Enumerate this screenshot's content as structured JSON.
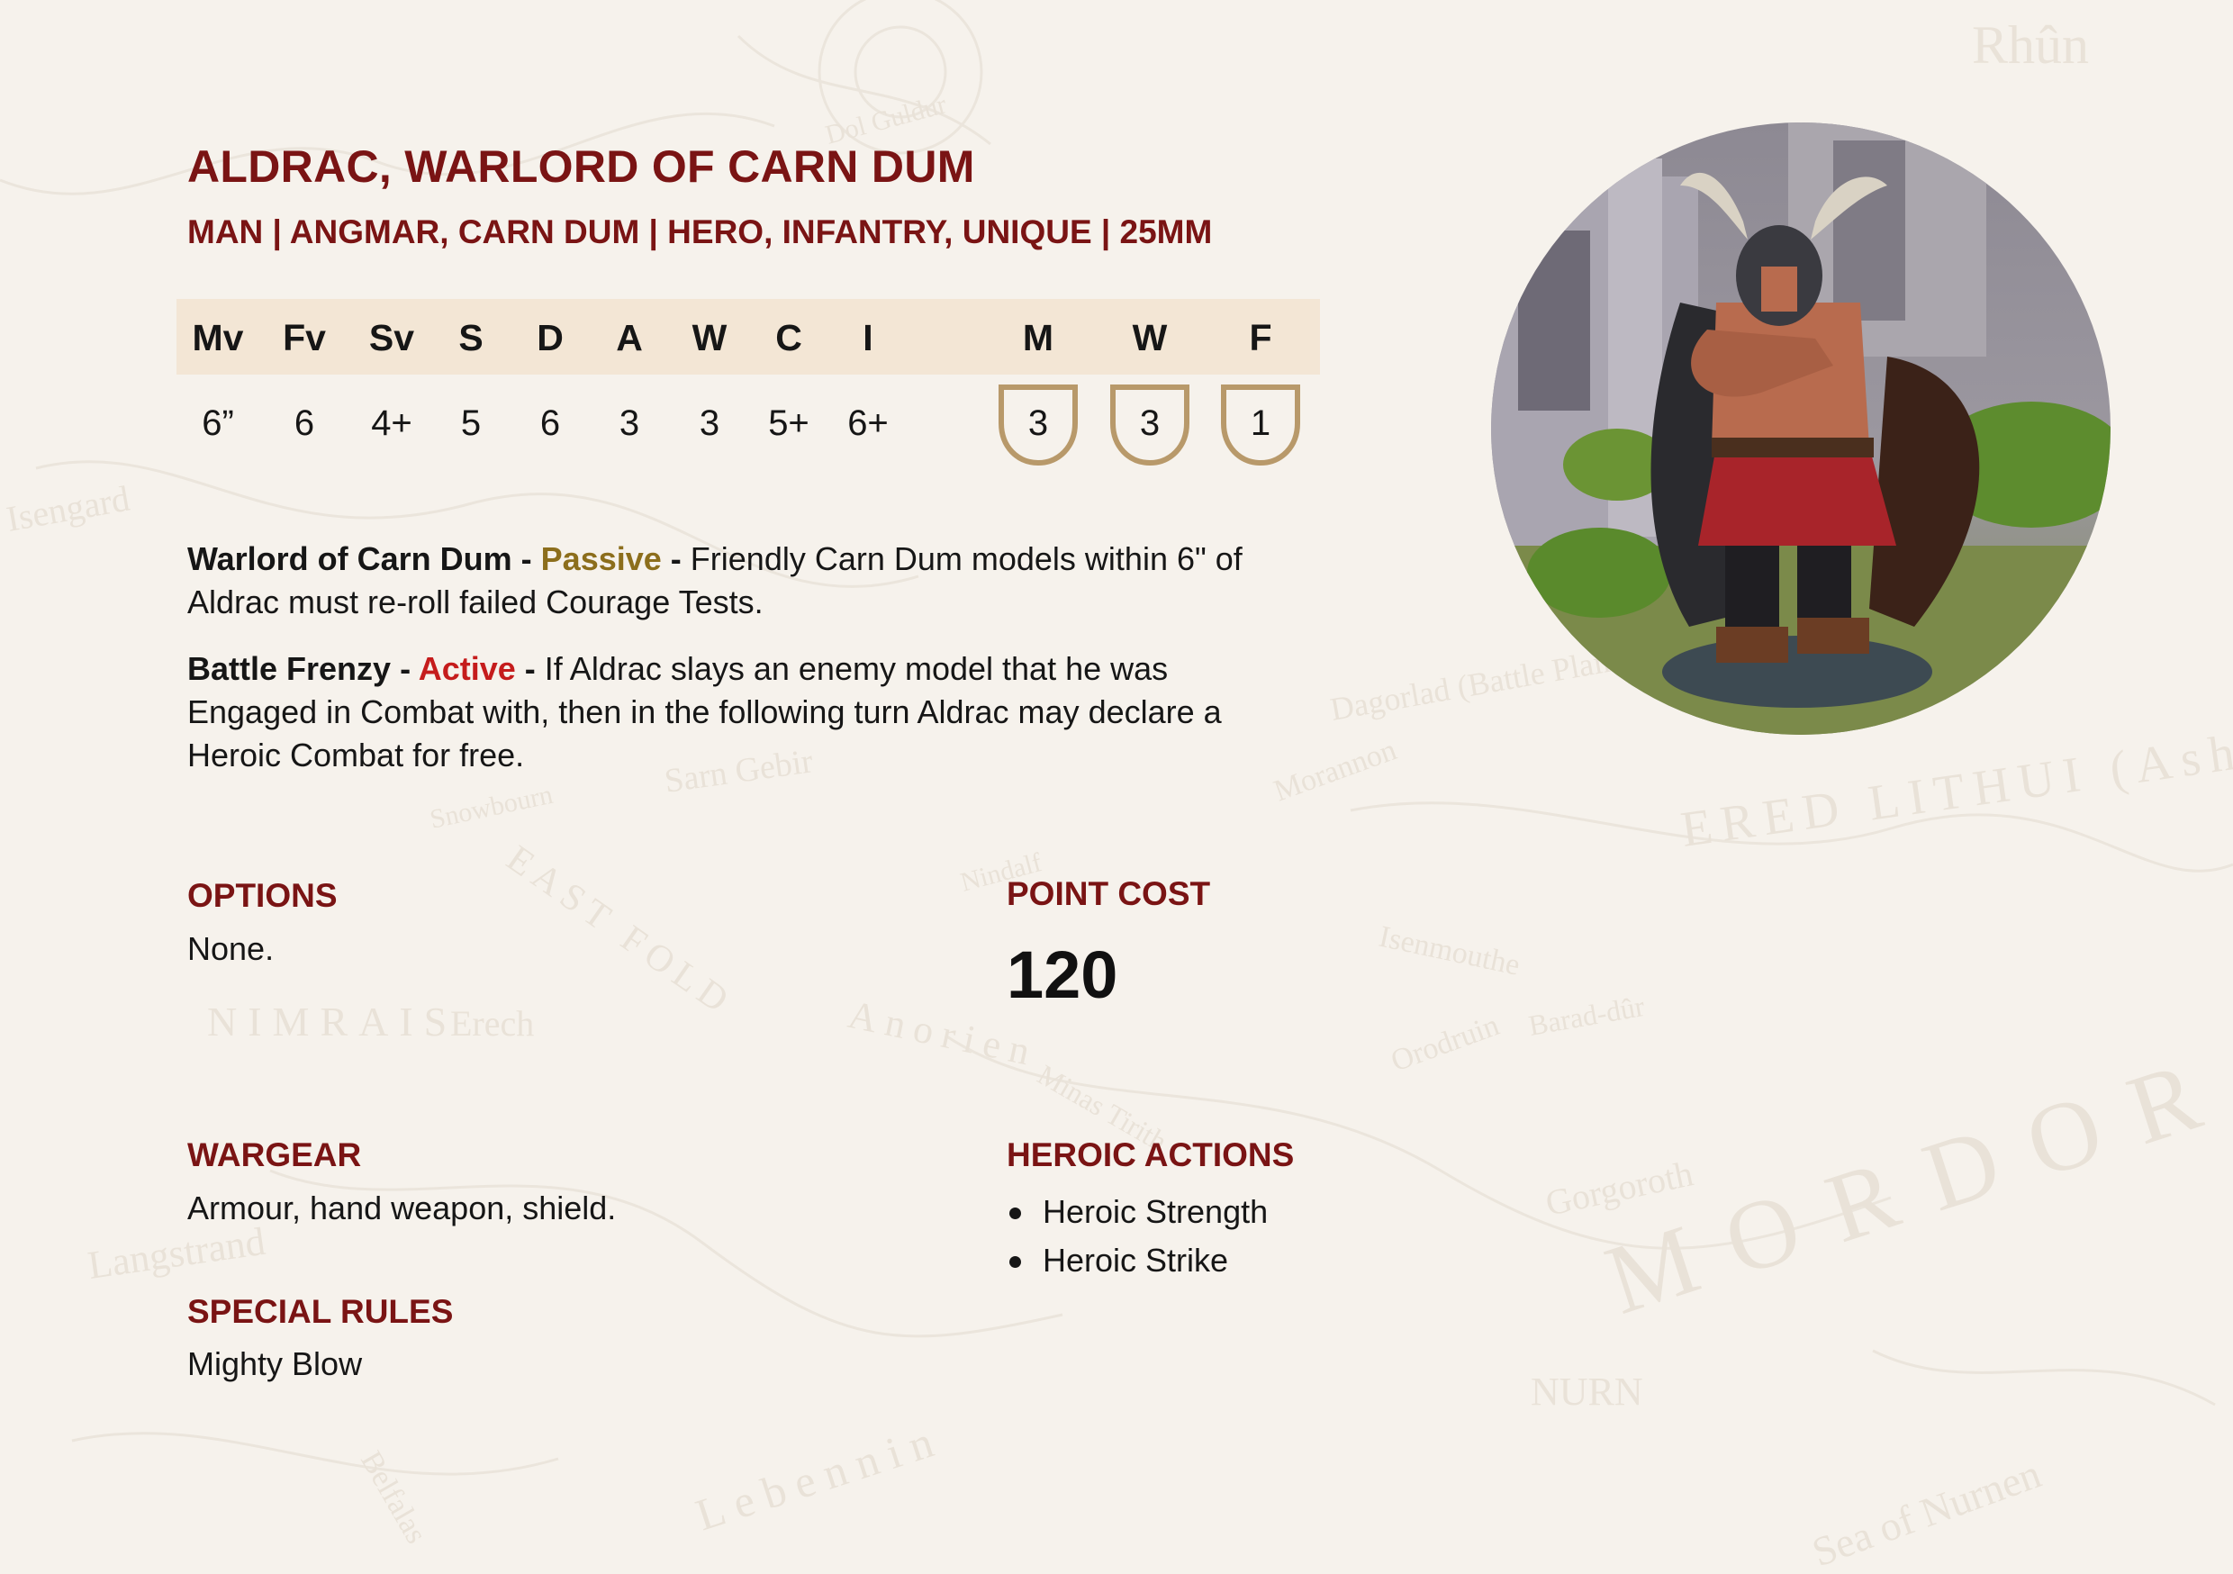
{
  "profile": {
    "name": "ALDRAC, WARLORD OF CARN DUM",
    "keywords": "MAN | ANGMAR, CARN DUM | HERO, INFANTRY, UNIQUE | 25MM"
  },
  "stats": {
    "columns": [
      {
        "label": "Mv",
        "value": "6”"
      },
      {
        "label": "Fv",
        "value": "6"
      },
      {
        "label": "Sv",
        "value": "4+"
      },
      {
        "label": "S",
        "value": "5"
      },
      {
        "label": "D",
        "value": "6"
      },
      {
        "label": "A",
        "value": "3"
      },
      {
        "label": "W",
        "value": "3"
      },
      {
        "label": "C",
        "value": "5+"
      },
      {
        "label": "I",
        "value": "6+"
      }
    ],
    "heroic": [
      {
        "label": "M",
        "value": "3"
      },
      {
        "label": "W",
        "value": "3"
      },
      {
        "label": "F",
        "value": "1"
      }
    ]
  },
  "rules": [
    {
      "name": "Warlord of Carn Dum",
      "separator": " - ",
      "type": "Passive",
      "text": "Friendly Carn Dum models within 6\" of Aldrac must re-roll failed Courage Tests."
    },
    {
      "name": "Battle Frenzy",
      "separator": " - ",
      "type": "Active",
      "text": "If Aldrac slays an enemy model that he was Engaged in Combat with, then in the following turn Aldrac may declare a Heroic Combat for free."
    }
  ],
  "options": {
    "title": "OPTIONS",
    "text": "None."
  },
  "point_cost": {
    "title": "POINT COST",
    "value": "120"
  },
  "wargear": {
    "title": "WARGEAR",
    "text": "Armour, hand weapon, shield."
  },
  "special_rules": {
    "title": "SPECIAL RULES",
    "text": "Mighty Blow"
  },
  "heroic_actions": {
    "title": "HEROIC ACTIONS",
    "items": [
      "Heroic Strength",
      "Heroic Strike"
    ]
  },
  "background_map_labels": [
    "Rhûn",
    "Isengard",
    "MORDOR",
    "ERED LITHUI (Ash",
    "NURN",
    "Sea of Nurnen",
    "Dagorlad (Battle Plain)",
    "Barad-dûr",
    "Gorgoroth",
    "Orodruin",
    "Morannon",
    "Isenmouthe",
    "NIMRAIS",
    "Erech",
    "Sarn Gebir",
    "Dol Guldur",
    "Nindalf",
    "EAST FOLD",
    "Snowbourn",
    "Anorien",
    "Minas Tirith",
    "Langstrand",
    "Belfalas",
    "Lebennin"
  ],
  "colors": {
    "accent": "#7a1414",
    "passive": "#8c6e1c",
    "active": "#c51c1c",
    "stat_band": "#f3e6d5",
    "shield_border": "#b8996a",
    "page": "#f6f2ec"
  }
}
